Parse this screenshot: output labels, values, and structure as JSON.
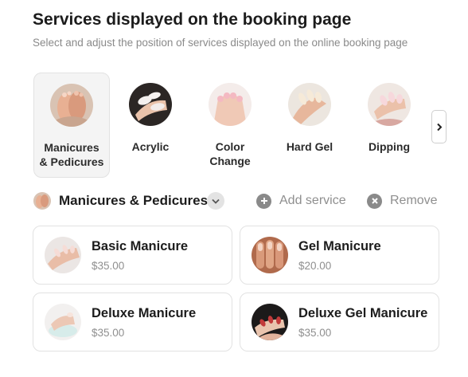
{
  "header": {
    "title": "Services displayed on the booking page",
    "subtitle": "Select and adjust the position of services displayed on the online booking page"
  },
  "categories": [
    {
      "line1": "Manicures",
      "line2": "& Pedicures",
      "icon": "feet-spa-thumbnail",
      "selected": true
    },
    {
      "line1": "Acrylic",
      "line2": "",
      "icon": "acrylic-nails-thumbnail",
      "selected": false
    },
    {
      "line1": "Color",
      "line2": "Change",
      "icon": "color-change-thumbnail",
      "selected": false
    },
    {
      "line1": "Hard Gel",
      "line2": "",
      "icon": "hard-gel-thumbnail",
      "selected": false
    },
    {
      "line1": "Dipping",
      "line2": "",
      "icon": "dipping-thumbnail",
      "selected": false
    }
  ],
  "selected_category": {
    "name": "Manicures & Pedicures",
    "add_label": "Add service",
    "remove_label": "Remove"
  },
  "services": [
    {
      "name": "Basic Manicure",
      "price": "$35.00"
    },
    {
      "name": "Gel Manicure",
      "price": "$20.00"
    },
    {
      "name": "Deluxe Manicure",
      "price": "$35.00"
    },
    {
      "name": "Deluxe Gel Manicure",
      "price": "$35.00"
    }
  ],
  "colors": {
    "skin": "#e6b9a3",
    "pink_nail": "#f3d0d4",
    "muted_text": "#8f8f8f",
    "border": "#e2e2e2"
  }
}
